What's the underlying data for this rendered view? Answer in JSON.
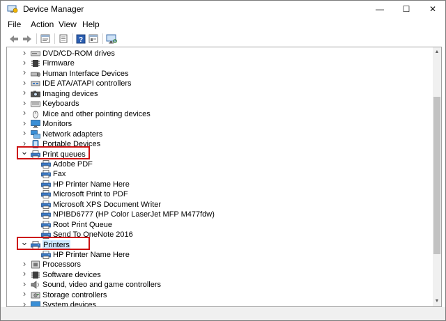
{
  "window": {
    "title": "Device Manager",
    "controls": {
      "minimize": "—",
      "maximize": "☐",
      "close": "✕"
    }
  },
  "menu": [
    "File",
    "Action",
    "View",
    "Help"
  ],
  "toolbar": [
    "back",
    "forward",
    "properties",
    "show-hidden",
    "help",
    "details",
    "scan-hardware"
  ],
  "tree": [
    {
      "label": "DVD/CD-ROM drives",
      "icon": "dvd-drive-icon",
      "level": 0,
      "state": "collapsed"
    },
    {
      "label": "Firmware",
      "icon": "firmware-icon",
      "level": 0,
      "state": "collapsed"
    },
    {
      "label": "Human Interface Devices",
      "icon": "hid-icon",
      "level": 0,
      "state": "collapsed"
    },
    {
      "label": "IDE ATA/ATAPI controllers",
      "icon": "ide-controller-icon",
      "level": 0,
      "state": "collapsed"
    },
    {
      "label": "Imaging devices",
      "icon": "imaging-device-icon",
      "level": 0,
      "state": "collapsed"
    },
    {
      "label": "Keyboards",
      "icon": "keyboard-icon",
      "level": 0,
      "state": "collapsed"
    },
    {
      "label": "Mice and other pointing devices",
      "icon": "mouse-icon",
      "level": 0,
      "state": "collapsed"
    },
    {
      "label": "Monitors",
      "icon": "monitor-icon",
      "level": 0,
      "state": "collapsed"
    },
    {
      "label": "Network adapters",
      "icon": "network-adapter-icon",
      "level": 0,
      "state": "collapsed"
    },
    {
      "label": "Portable Devices",
      "icon": "portable-device-icon",
      "level": 0,
      "state": "collapsed"
    },
    {
      "label": "Print queues",
      "icon": "printer-icon",
      "level": 0,
      "state": "expanded",
      "highlighted": true
    },
    {
      "label": "Adobe PDF",
      "icon": "printer-icon",
      "level": 1
    },
    {
      "label": "Fax",
      "icon": "printer-icon",
      "level": 1
    },
    {
      "label": "HP Printer Name Here",
      "icon": "printer-icon",
      "level": 1
    },
    {
      "label": "Microsoft Print to PDF",
      "icon": "printer-icon",
      "level": 1
    },
    {
      "label": "Microsoft XPS Document Writer",
      "icon": "printer-icon",
      "level": 1
    },
    {
      "label": "NPIBD6777 (HP Color LaserJet MFP M477fdw)",
      "icon": "printer-icon",
      "level": 1
    },
    {
      "label": "Root Print Queue",
      "icon": "printer-icon",
      "level": 1
    },
    {
      "label": "Send To OneNote 2016",
      "icon": "printer-icon",
      "level": 1
    },
    {
      "label": "Printers",
      "icon": "printer-icon",
      "level": 0,
      "state": "expanded",
      "highlighted": true,
      "selected": true
    },
    {
      "label": "HP Printer Name Here",
      "icon": "printer-icon",
      "level": 1
    },
    {
      "label": "Processors",
      "icon": "processor-icon",
      "level": 0,
      "state": "collapsed"
    },
    {
      "label": "Software devices",
      "icon": "software-device-icon",
      "level": 0,
      "state": "collapsed"
    },
    {
      "label": "Sound, video and game controllers",
      "icon": "sound-icon",
      "level": 0,
      "state": "collapsed"
    },
    {
      "label": "Storage controllers",
      "icon": "storage-controller-icon",
      "level": 0,
      "state": "collapsed"
    },
    {
      "label": "System devices",
      "icon": "system-device-icon",
      "level": 0,
      "state": "collapsed"
    }
  ],
  "colors": {
    "highlight_border": "#cc1111",
    "selection": "#cce8ff",
    "scrollbar_thumb": "#c2c2c2"
  }
}
